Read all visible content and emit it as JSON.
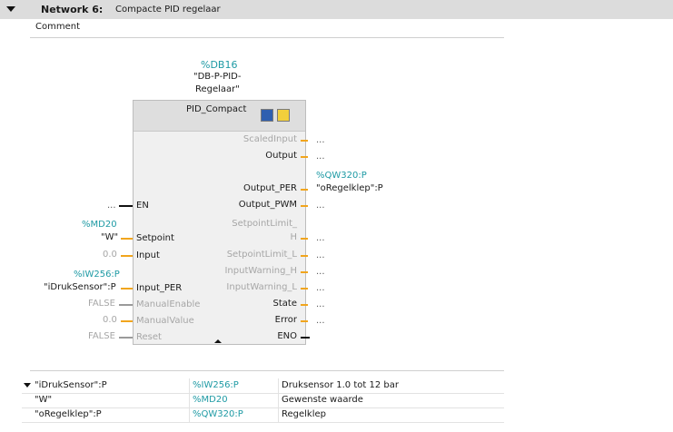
{
  "network": {
    "title": "Network 6:",
    "description": "Compacte PID regelaar",
    "comment": "Comment"
  },
  "instance": {
    "address": "%DB16",
    "name_line1": "\"DB-P-PID-",
    "name_line2": "Regelaar\""
  },
  "block": {
    "title": "PID_Compact"
  },
  "outputs": {
    "scaled_input": "ScaledInput",
    "output": "Output",
    "output_per": "Output_PER",
    "output_pwm": "Output_PWM",
    "setpoint_limit_h_1": "SetpointLimit_",
    "setpoint_limit_h_2": "H",
    "setpoint_limit_l": "SetpointLimit_L",
    "input_warning_h": "InputWarning_H",
    "input_warning_l": "InputWarning_L",
    "state": "State",
    "error": "Error",
    "eno": "ENO"
  },
  "output_values": {
    "dots": "...",
    "output_per_addr": "%QW320:P",
    "output_per_tag": "\"oRegelklep\":P"
  },
  "inputs": {
    "en": "EN",
    "setpoint": "Setpoint",
    "input": "Input",
    "input_per": "Input_PER",
    "manual_enable": "ManualEnable",
    "manual_value": "ManualValue",
    "reset": "Reset"
  },
  "input_values": {
    "en": "...",
    "setpoint_addr": "%MD20",
    "setpoint_tag": "\"W\"",
    "input": "0.0",
    "input_per_addr": "%IW256:P",
    "input_per_tag": "\"iDrukSensor\":P",
    "manual_enable": "FALSE",
    "manual_value": "0.0",
    "reset": "FALSE"
  },
  "tag_table": [
    {
      "name": "\"iDrukSensor\":P",
      "address": "%IW256:P",
      "comment": "Druksensor 1.0 tot 12 bar"
    },
    {
      "name": "\"W\"",
      "address": "%MD20",
      "comment": "Gewenste waarde"
    },
    {
      "name": "\"oRegelklep\":P",
      "address": "%QW320:P",
      "comment": "Regelklep"
    }
  ],
  "colors": {
    "address": "#1e9aa4",
    "header_bg": "#dcdcdc",
    "block_bg": "#f0f0f0",
    "wire_optional": "#f1a51d"
  }
}
